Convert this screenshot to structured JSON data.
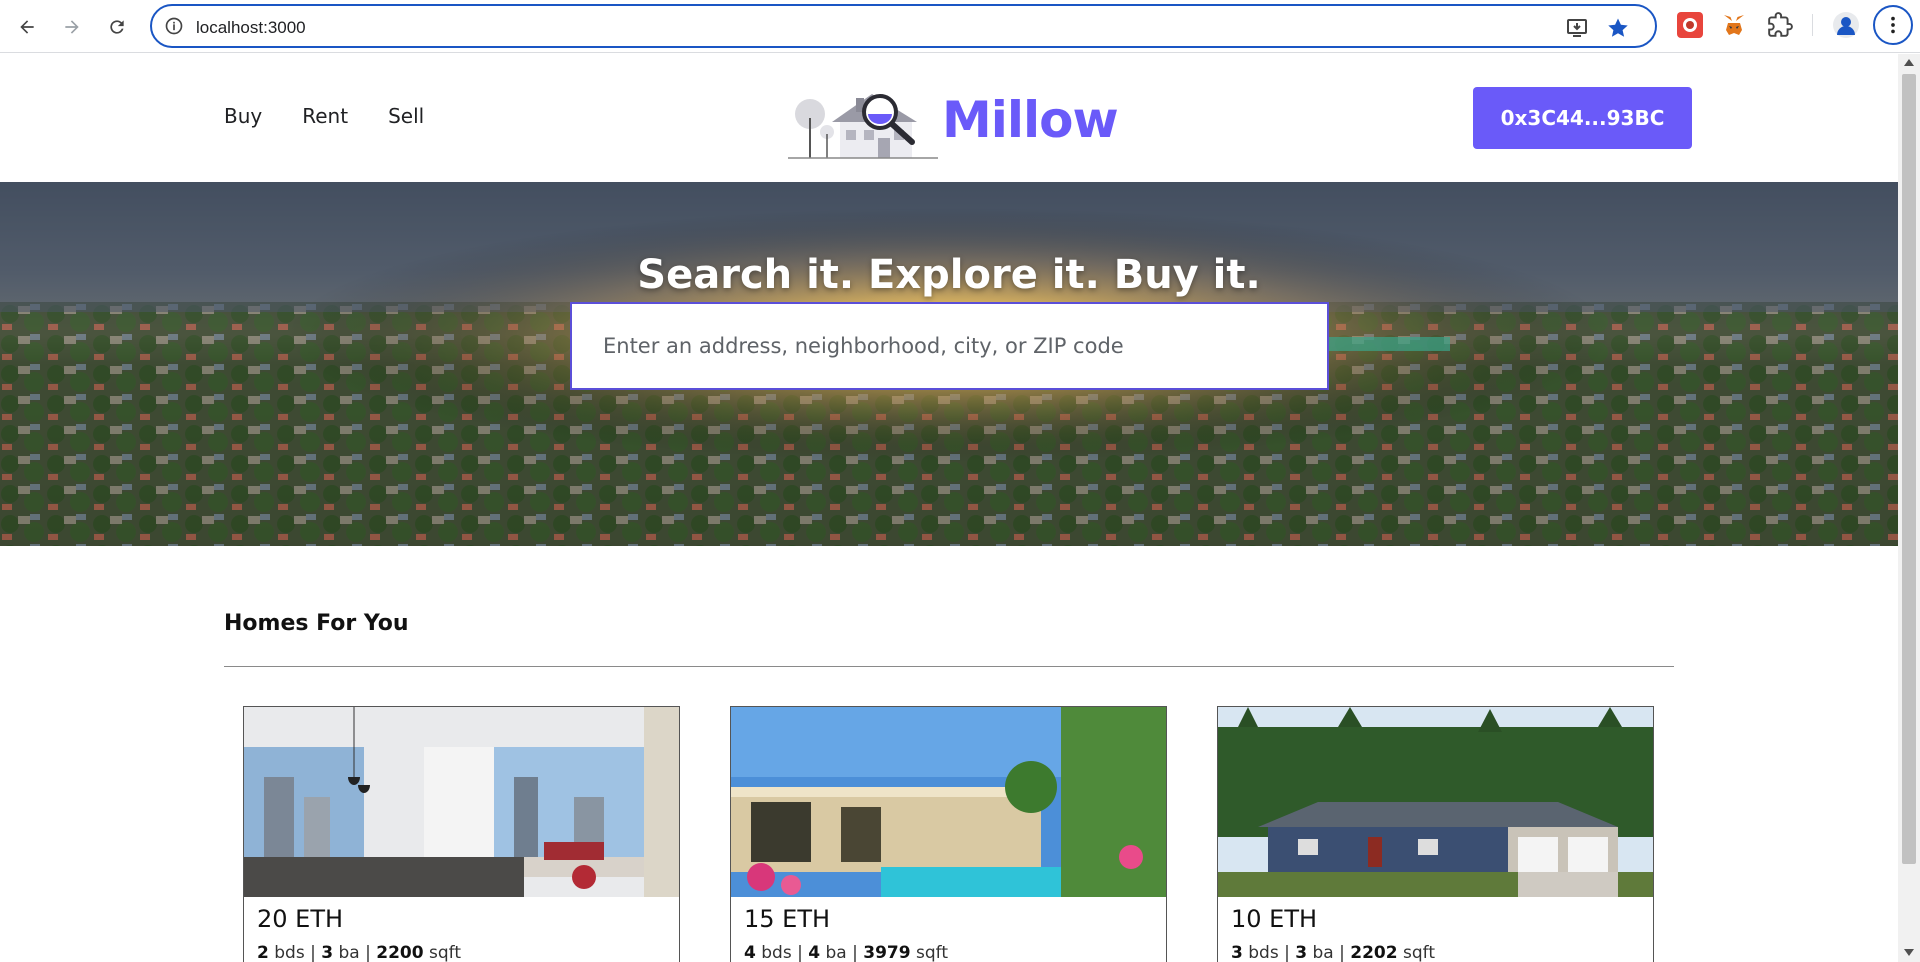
{
  "browser": {
    "url": "localhost:3000",
    "icons": {
      "back": "back-arrow-icon",
      "forward": "forward-arrow-icon",
      "reload": "reload-icon",
      "site_info": "site-info-icon",
      "install": "install-app-icon",
      "bookmark": "bookmark-star-icon",
      "extensions": "puzzle-piece-icon",
      "profile": "profile-avatar-icon",
      "menu": "kebab-menu-icon"
    },
    "accent": "#1a56c4"
  },
  "header": {
    "nav": [
      {
        "label": "Buy"
      },
      {
        "label": "Rent"
      },
      {
        "label": "Sell"
      }
    ],
    "brand": "Millow",
    "wallet_address": "0x3C44...93BC",
    "brand_color": "#6a5af9"
  },
  "hero": {
    "title": "Search it. Explore it. Buy it.",
    "search_placeholder": "Enter an address, neighborhood, city, or ZIP code"
  },
  "homes": {
    "title": "Homes For You",
    "cards": [
      {
        "price": "20 ETH",
        "beds": "2",
        "beds_label": "bds",
        "baths": "3",
        "baths_label": "ba",
        "sqft": "2200",
        "sqft_label": "sqft"
      },
      {
        "price": "15 ETH",
        "beds": "4",
        "beds_label": "bds",
        "baths": "4",
        "baths_label": "ba",
        "sqft": "3979",
        "sqft_label": "sqft"
      },
      {
        "price": "10 ETH",
        "beds": "3",
        "beds_label": "bds",
        "baths": "3",
        "baths_label": "ba",
        "sqft": "2202",
        "sqft_label": "sqft"
      }
    ]
  }
}
